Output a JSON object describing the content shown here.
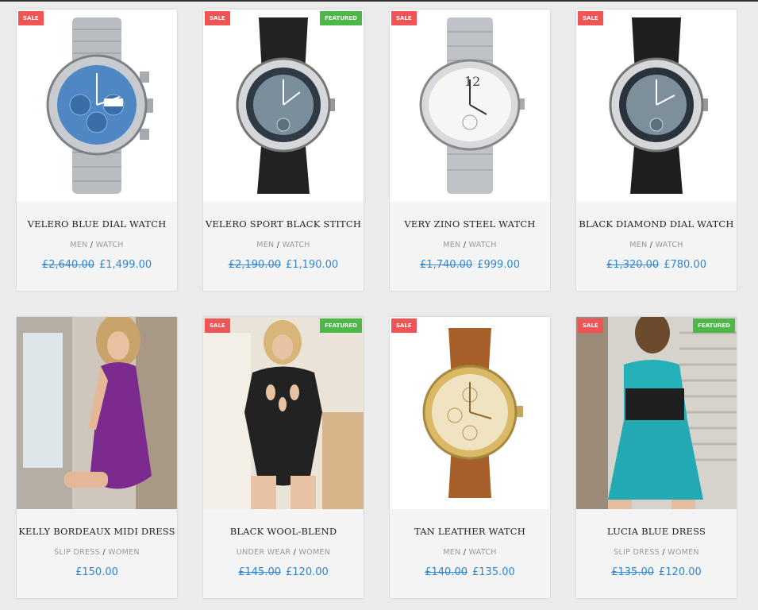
{
  "colors": {
    "sale": "#f05454",
    "featured": "#4cb848",
    "price": "#2e86d6"
  },
  "products": [
    {
      "title": "Velero Blue Dial Watch",
      "category": "MEN",
      "subcategory": "WATCH",
      "old_price": "£2,640.00",
      "price": "£1,499.00",
      "sale_badge": "SALE",
      "featured_badge": "",
      "image": "blue-chronograph-watch-image"
    },
    {
      "title": "Velero Sport Black Stitch",
      "category": "MEN",
      "subcategory": "WATCH",
      "old_price": "£2,190.00",
      "price": "£1,190.00",
      "sale_badge": "SALE",
      "featured_badge": "FEATURED",
      "image": "black-strap-watch-image"
    },
    {
      "title": "Very Zino Steel Watch",
      "category": "MEN",
      "subcategory": "WATCH",
      "old_price": "£1,740.00",
      "price": "£999.00",
      "sale_badge": "SALE",
      "featured_badge": "",
      "image": "steel-white-dial-watch-image"
    },
    {
      "title": "Black Diamond Dial Watch",
      "category": "MEN",
      "subcategory": "WATCH",
      "old_price": "£1,320.00",
      "price": "£780.00",
      "sale_badge": "SALE",
      "featured_badge": "",
      "image": "black-diamond-watch-image"
    },
    {
      "title": "Kelly Bordeaux Midi Dress",
      "category": "SLIP DRESS",
      "subcategory": "WOMEN",
      "old_price": "",
      "price": "£150.00",
      "sale_badge": "",
      "featured_badge": "",
      "image": "purple-slip-dress-image"
    },
    {
      "title": "Black Wool-Blend",
      "category": "UNDER WEAR",
      "subcategory": "WOMEN",
      "old_price": "£145.00",
      "price": "£120.00",
      "sale_badge": "SALE",
      "featured_badge": "FEATURED",
      "image": "black-bodysuit-image"
    },
    {
      "title": "Tan Leather Watch",
      "category": "MEN",
      "subcategory": "WATCH",
      "old_price": "£140.00",
      "price": "£135.00",
      "sale_badge": "SALE",
      "featured_badge": "",
      "image": "gold-tan-leather-watch-image"
    },
    {
      "title": "Lucia Blue Dress",
      "category": "SLIP DRESS",
      "subcategory": "WOMEN",
      "old_price": "£135.00",
      "price": "£120.00",
      "sale_badge": "SALE",
      "featured_badge": "FEATURED",
      "image": "turquoise-lace-dress-image"
    }
  ]
}
